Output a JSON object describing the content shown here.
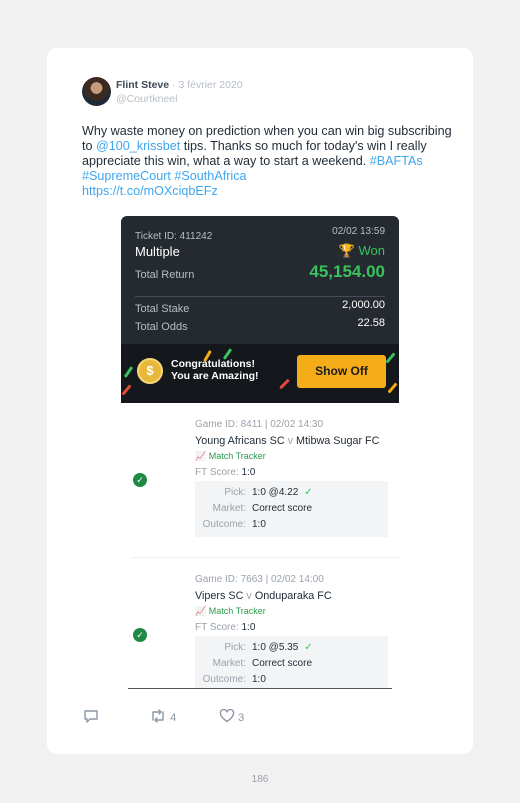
{
  "tweet": {
    "author_name": "Flint Steve",
    "date": "· 3 février 2020",
    "handle": "@Courtkneel",
    "text_1": "Why waste money on prediction when you can win big subscribing to ",
    "mention": "@100_krissbet",
    "text_2": " tips. Thanks so much for today's win I really appreciate this win, what a way to start a weekend. ",
    "hashtags": "#BAFTAs #SupremeCourt #SouthAfrica",
    "url": "https://t.co/mOXciqbEFz",
    "replies": "",
    "retweets": "4",
    "likes": "3"
  },
  "ticket": {
    "id_label": "Ticket ID: 411242",
    "datetime": "02/02 13:59",
    "type": "Multiple",
    "status": "Won",
    "total_return_label": "Total Return",
    "total_return": "45,154.00",
    "total_stake_label": "Total Stake",
    "total_stake": "2,000.00",
    "total_odds_label": "Total Odds",
    "total_odds": "22.58",
    "congrats_line1": "Congratulations!",
    "congrats_line2": "You are Amazing!",
    "show_off": "Show Off",
    "coin_symbol": "$"
  },
  "bets": [
    {
      "game": "Game ID: 8411 | 02/02 14:30",
      "home": "Young Africans SC",
      "vs": "v",
      "away": "Mtibwa Sugar FC",
      "tracker": "Match Tracker",
      "ft_label": "FT Score:",
      "ft_score": "1:0",
      "pick_label": "Pick:",
      "pick": "1:0 @4.22",
      "market_label": "Market:",
      "market": "Correct score",
      "outcome_label": "Outcome:",
      "outcome": "1:0"
    },
    {
      "game": "Game ID: 7663 | 02/02 14:00",
      "home": "Vipers SC",
      "vs": "v",
      "away": "Onduparaka FC",
      "tracker": "Match Tracker",
      "ft_label": "FT Score:",
      "ft_score": "1:0",
      "pick_label": "Pick:",
      "pick": "1:0 @5.35",
      "market_label": "Market:",
      "market": "Correct score",
      "outcome_label": "Outcome:",
      "outcome": "1:0"
    }
  ],
  "page_number": "186",
  "colors": {
    "accent_green": "#39c25e",
    "link_blue": "#3ea6ee",
    "button_orange": "#f4ad18",
    "ticket_bg": "#252a30"
  }
}
